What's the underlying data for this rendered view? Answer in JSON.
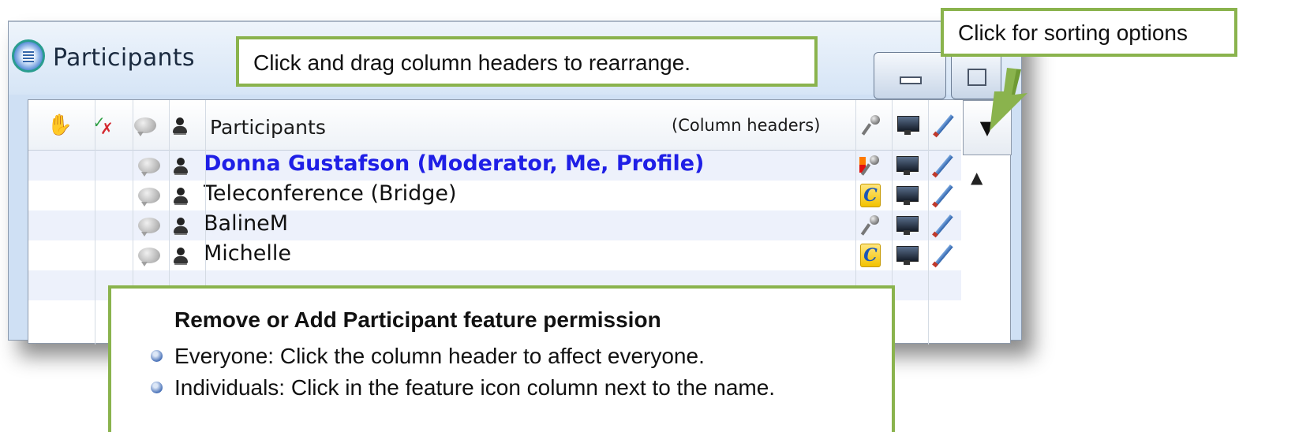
{
  "window": {
    "title": "Participants"
  },
  "list": {
    "column_header_label": "Participants",
    "column_header_note": "(Column headers)",
    "header_icons": [
      "raise-hand-icon",
      "check-x-icon",
      "chat-icon",
      "webcam-icon",
      "microphone-icon",
      "desktop-share-icon",
      "annotate-pen-icon"
    ],
    "sort_button_glyph": "▼",
    "scroll_up_glyph": "▲",
    "phone_glyph": "C",
    "participants": [
      {
        "name": "Donna Gustafson (Moderator, Me, Profile)",
        "role": "moderator",
        "audio": "microphone-talking-icon"
      },
      {
        "name": "Teleconference (Bridge)",
        "role": "participant",
        "audio": "phone-icon"
      },
      {
        "name": "BalineM",
        "role": "participant",
        "audio": "microphone-icon"
      },
      {
        "name": "Michelle",
        "role": "participant",
        "audio": "phone-icon"
      }
    ]
  },
  "callouts": {
    "drag": "Click and drag column headers to rearrange.",
    "sort": "Click for sorting options",
    "permission_title": "Remove or Add Participant feature permission",
    "permission_items": [
      "Everyone: Click the column header to affect everyone.",
      "Individuals: Click in the feature icon column next to the name."
    ]
  },
  "colors": {
    "callout_border": "#8ab34d",
    "moderator_name": "#1f1fe6",
    "alt_row": "#edf1fb"
  }
}
